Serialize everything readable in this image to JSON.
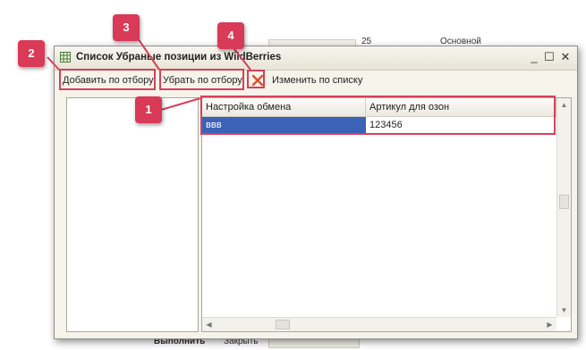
{
  "background": {
    "fragment_1": "25",
    "fragment_2": "Основной",
    "fragment_3": "Выполнить",
    "fragment_4": "Закрыть"
  },
  "window": {
    "title": "Список Убраные позиции из WildBerries",
    "controls": {
      "minimize": "_",
      "maximize": "☐",
      "close": "✕"
    }
  },
  "toolbar": {
    "add_by_filter": "Добавить по отбору",
    "remove_by_filter": "Убрать по отбору",
    "delete_icon": "delete-icon",
    "change_by_list": "Изменить по списку"
  },
  "grid": {
    "columns": [
      "Настройка обмена",
      "Артикул для озон"
    ],
    "rows": [
      [
        "ввв",
        "123456"
      ]
    ]
  },
  "annotations": {
    "badge_1": "1",
    "badge_2": "2",
    "badge_3": "3",
    "badge_4": "4",
    "color": "#d93a57"
  }
}
